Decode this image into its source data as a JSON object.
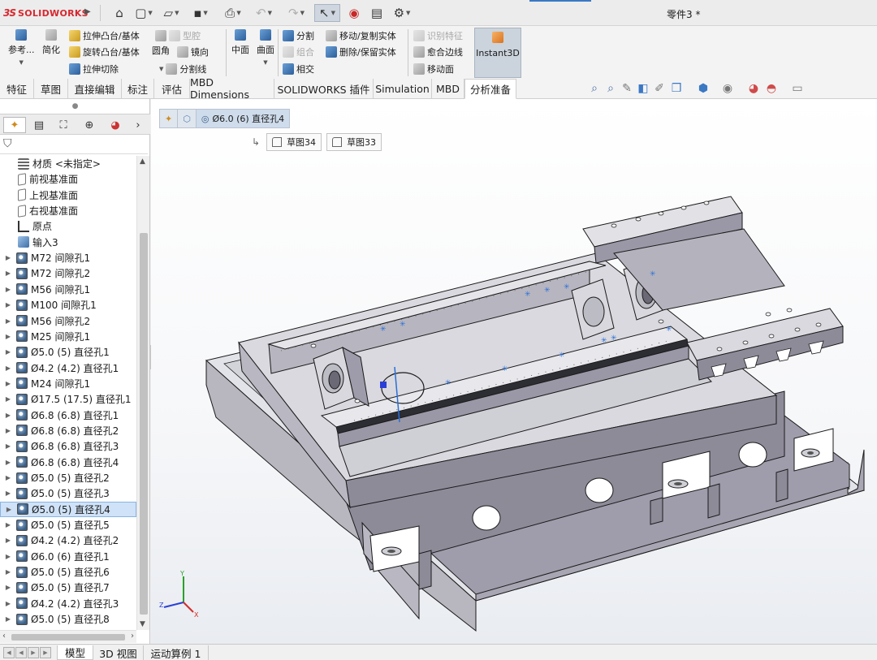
{
  "app": {
    "logo_ds": "3S",
    "logo_text": "SOLIDWORKS",
    "document_title": "零件3 *"
  },
  "quick_access": [
    {
      "name": "home",
      "glyph": "⌂"
    },
    {
      "name": "new",
      "glyph": "▢"
    },
    {
      "name": "open",
      "glyph": "▱"
    },
    {
      "name": "save",
      "glyph": "▪"
    },
    {
      "name": "print",
      "glyph": "⎙"
    },
    {
      "name": "undo",
      "glyph": "↶"
    },
    {
      "name": "redo",
      "glyph": "↷"
    },
    {
      "name": "select",
      "glyph": "↖"
    },
    {
      "name": "rebuild",
      "glyph": "◉"
    },
    {
      "name": "file-properties",
      "glyph": "▤"
    },
    {
      "name": "options",
      "glyph": "⚙"
    }
  ],
  "ribbon": {
    "reference": "参考...",
    "simplify": "简化",
    "extrude_boss": "拉伸凸台/基体",
    "revolve_boss": "旋转凸台/基体",
    "extrude_cut": "拉伸切除",
    "shell": "型腔",
    "fillet": "圆角",
    "mirror": "镜向",
    "split_line": "分割线",
    "midplane": "中面",
    "surface": "曲面",
    "split": "分割",
    "combine": "组合",
    "intersect": "相交",
    "move_copy": "移动/复制实体",
    "delete_keep": "删除/保留实体",
    "recognize": "识别特征",
    "knit_edge": "愈合边线",
    "move_face": "移动面",
    "instant3d": "Instant3D"
  },
  "command_tabs": [
    "特征",
    "草图",
    "直接编辑",
    "标注",
    "评估",
    "MBD Dimensions",
    "SOLIDWORKS 插件",
    "Simulation",
    "MBD",
    "分析准备"
  ],
  "active_command_tab": "分析准备",
  "manager_tabs": [
    "feature-manager",
    "property-manager",
    "configuration-manager",
    "dimxpert-manager",
    "display-manager"
  ],
  "tree": [
    {
      "label": "材质 <未指定>",
      "icon": "material",
      "expand": false
    },
    {
      "label": "前视基准面",
      "icon": "plane",
      "expand": false
    },
    {
      "label": "上视基准面",
      "icon": "plane",
      "expand": false
    },
    {
      "label": "右视基准面",
      "icon": "plane",
      "expand": false
    },
    {
      "label": "原点",
      "icon": "origin",
      "expand": false
    },
    {
      "label": "输入3",
      "icon": "import",
      "expand": false
    },
    {
      "label": "M72 间隙孔1",
      "icon": "feature",
      "expand": true
    },
    {
      "label": "M72 间隙孔2",
      "icon": "feature",
      "expand": true
    },
    {
      "label": "M56 间隙孔1",
      "icon": "feature",
      "expand": true
    },
    {
      "label": "M100 间隙孔1",
      "icon": "feature",
      "expand": true
    },
    {
      "label": "M56 间隙孔2",
      "icon": "feature",
      "expand": true
    },
    {
      "label": "M25 间隙孔1",
      "icon": "feature",
      "expand": true
    },
    {
      "label": "Ø5.0 (5) 直径孔1",
      "icon": "feature",
      "expand": true
    },
    {
      "label": "Ø4.2 (4.2) 直径孔1",
      "icon": "feature",
      "expand": true
    },
    {
      "label": "M24 间隙孔1",
      "icon": "feature",
      "expand": true
    },
    {
      "label": "Ø17.5 (17.5) 直径孔1",
      "icon": "feature",
      "expand": true
    },
    {
      "label": "Ø6.8 (6.8) 直径孔1",
      "icon": "feature",
      "expand": true
    },
    {
      "label": "Ø6.8 (6.8) 直径孔2",
      "icon": "feature",
      "expand": true
    },
    {
      "label": "Ø6.8 (6.8) 直径孔3",
      "icon": "feature",
      "expand": true
    },
    {
      "label": "Ø6.8 (6.8) 直径孔4",
      "icon": "feature",
      "expand": true
    },
    {
      "label": "Ø5.0 (5) 直径孔2",
      "icon": "feature",
      "expand": true
    },
    {
      "label": "Ø5.0 (5) 直径孔3",
      "icon": "feature",
      "expand": true
    },
    {
      "label": "Ø5.0 (5) 直径孔4",
      "icon": "feature",
      "expand": true,
      "selected": true
    },
    {
      "label": "Ø5.0 (5) 直径孔5",
      "icon": "feature",
      "expand": true
    },
    {
      "label": "Ø4.2 (4.2) 直径孔2",
      "icon": "feature",
      "expand": true
    },
    {
      "label": "Ø6.0 (6) 直径孔1",
      "icon": "feature",
      "expand": true
    },
    {
      "label": "Ø5.0 (5) 直径孔6",
      "icon": "feature",
      "expand": true
    },
    {
      "label": "Ø5.0 (5) 直径孔7",
      "icon": "feature",
      "expand": true
    },
    {
      "label": "Ø4.2 (4.2) 直径孔3",
      "icon": "feature",
      "expand": true
    },
    {
      "label": "Ø5.0 (5) 直径孔8",
      "icon": "feature",
      "expand": true
    }
  ],
  "breadcrumb": {
    "selected": "Ø6.0 (6) 直径孔4",
    "parents": [
      "草图34",
      "草图33"
    ]
  },
  "triad": {
    "x": "X",
    "y": "Y",
    "z": "Z"
  },
  "bottom_tabs": [
    "模型",
    "3D 视图",
    "运动算例 1"
  ],
  "active_bottom_tab": "模型",
  "colors": {
    "model_face": "#c4c4cc",
    "model_face_light": "#dcdde3",
    "model_face_dark": "#8d8a96",
    "model_edge": "#1a1a1a",
    "accent": "#3a78c4",
    "selection": "#cfe2f7",
    "brand_red": "#d7282f"
  }
}
